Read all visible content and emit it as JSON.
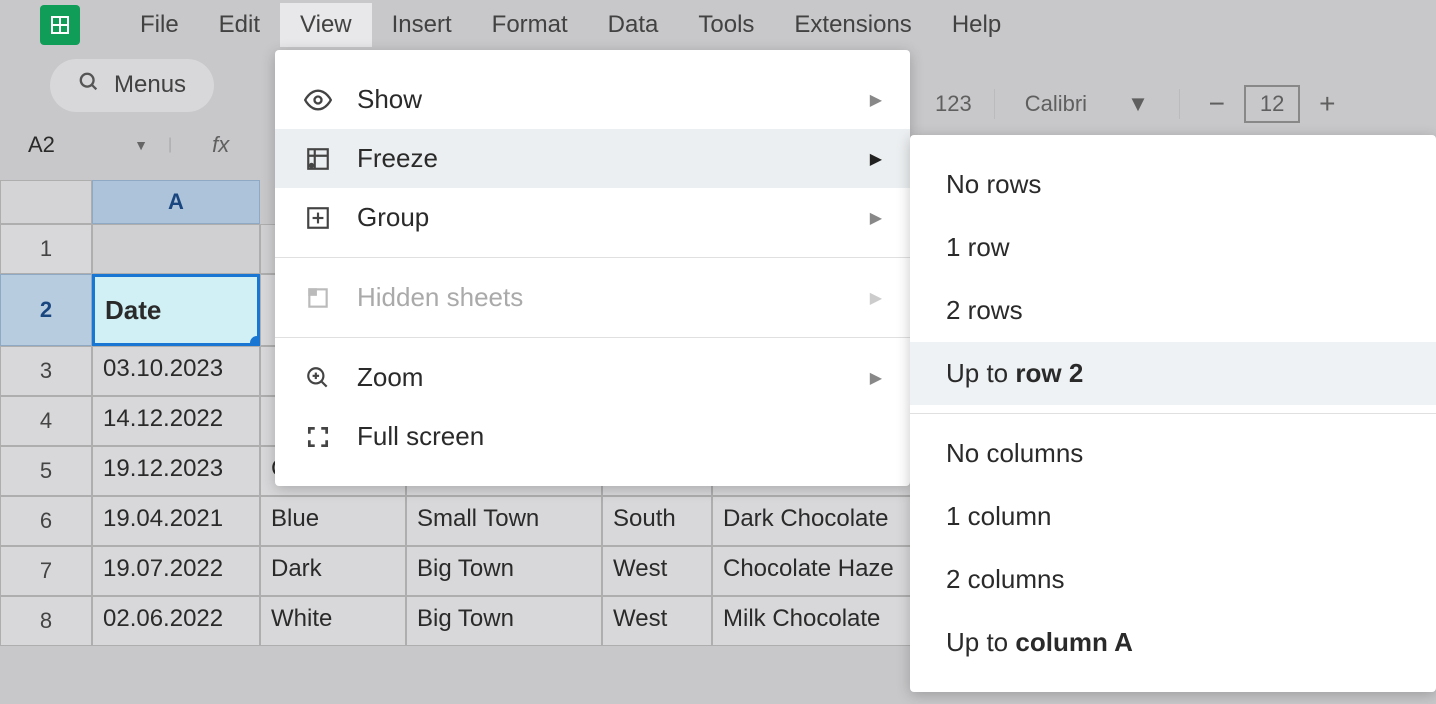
{
  "menubar": {
    "items": [
      "File",
      "Edit",
      "View",
      "Insert",
      "Format",
      "Data",
      "Tools",
      "Extensions",
      "Help"
    ],
    "active_index": 2
  },
  "toolbar": {
    "menus_label": "Menus",
    "format_number": "123",
    "font_name": "Calibri",
    "font_size": "12"
  },
  "cell_ref": "A2",
  "view_menu": {
    "items": [
      {
        "label": "Show",
        "icon": "eye-icon"
      },
      {
        "label": "Freeze",
        "icon": "freeze-icon",
        "highlighted": true
      },
      {
        "label": "Group",
        "icon": "group-icon"
      },
      {
        "label": "Hidden sheets",
        "icon": "sheet-icon",
        "disabled": true
      },
      {
        "label": "Zoom",
        "icon": "zoom-icon"
      },
      {
        "label": "Full screen",
        "icon": "fullscreen-icon"
      }
    ]
  },
  "freeze_submenu": {
    "row_items": [
      {
        "text": "No rows"
      },
      {
        "text": "1 row"
      },
      {
        "text": "2 rows"
      },
      {
        "prefix": "Up to ",
        "bold": "row 2",
        "highlighted": true
      }
    ],
    "col_items": [
      {
        "text": "No columns"
      },
      {
        "text": "1 column"
      },
      {
        "text": "2 columns"
      },
      {
        "prefix": "Up to ",
        "bold": "column A"
      }
    ]
  },
  "sheet": {
    "column_label": "A",
    "header_row": [
      "Date"
    ],
    "rows": [
      {
        "n": "1",
        "cells": [
          "",
          "",
          "",
          "",
          ""
        ]
      },
      {
        "n": "2",
        "cells": [
          "Date",
          "",
          "",
          "",
          ""
        ],
        "header": true,
        "selected_col": 0
      },
      {
        "n": "3",
        "cells": [
          "03.10.2023",
          "",
          "",
          "",
          ""
        ]
      },
      {
        "n": "4",
        "cells": [
          "14.12.2022",
          "",
          "",
          "",
          ""
        ]
      },
      {
        "n": "5",
        "cells": [
          "19.12.2023",
          "C",
          "",
          "",
          ""
        ]
      },
      {
        "n": "6",
        "cells": [
          "19.04.2021",
          "Blue",
          "Small Town",
          "South",
          "Dark Chocolate"
        ]
      },
      {
        "n": "7",
        "cells": [
          "19.07.2022",
          "Dark",
          "Big Town",
          "West",
          "Chocolate Haze"
        ]
      },
      {
        "n": "8",
        "cells": [
          "02.06.2022",
          "White",
          "Big Town",
          "West",
          "Milk Chocolate"
        ]
      }
    ]
  }
}
